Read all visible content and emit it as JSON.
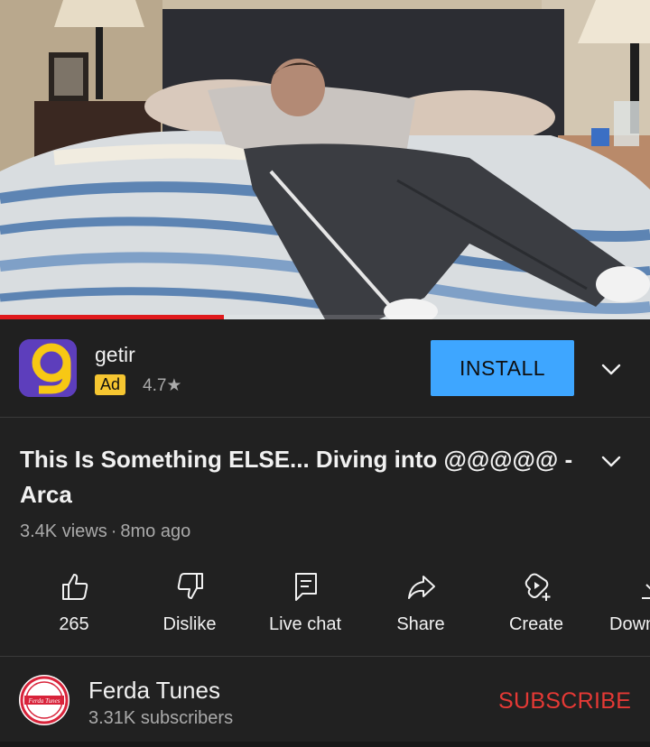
{
  "video": {
    "progress_fraction": 0.345,
    "accent_color": "#e0191c"
  },
  "ad": {
    "app_name": "getir",
    "badge": "Ad",
    "rating": "4.7★",
    "install_label": "INSTALL",
    "logo_icon": "getir-logo",
    "logo_color": "#5d3ebc",
    "logo_accent": "#f7c814",
    "button_color": "#3ea6ff"
  },
  "video_info": {
    "title": "This Is Something ELSE... Diving into @@@@@ - Arca",
    "views": "3.4K views",
    "separator": "·",
    "age": "8mo ago"
  },
  "actions": [
    {
      "icon": "thumbs-up-icon",
      "label": "265"
    },
    {
      "icon": "thumbs-down-icon",
      "label": "Dislike"
    },
    {
      "icon": "live-chat-icon",
      "label": "Live chat"
    },
    {
      "icon": "share-icon",
      "label": "Share"
    },
    {
      "icon": "create-icon",
      "label": "Create"
    },
    {
      "icon": "download-icon",
      "label": "Down"
    }
  ],
  "channel": {
    "name": "Ferda Tunes",
    "subscribers": "3.31K subscribers",
    "avatar_text": "Ferda Tunes",
    "subscribe_label": "SUBSCRIBE",
    "subscribe_color": "#e53935"
  }
}
